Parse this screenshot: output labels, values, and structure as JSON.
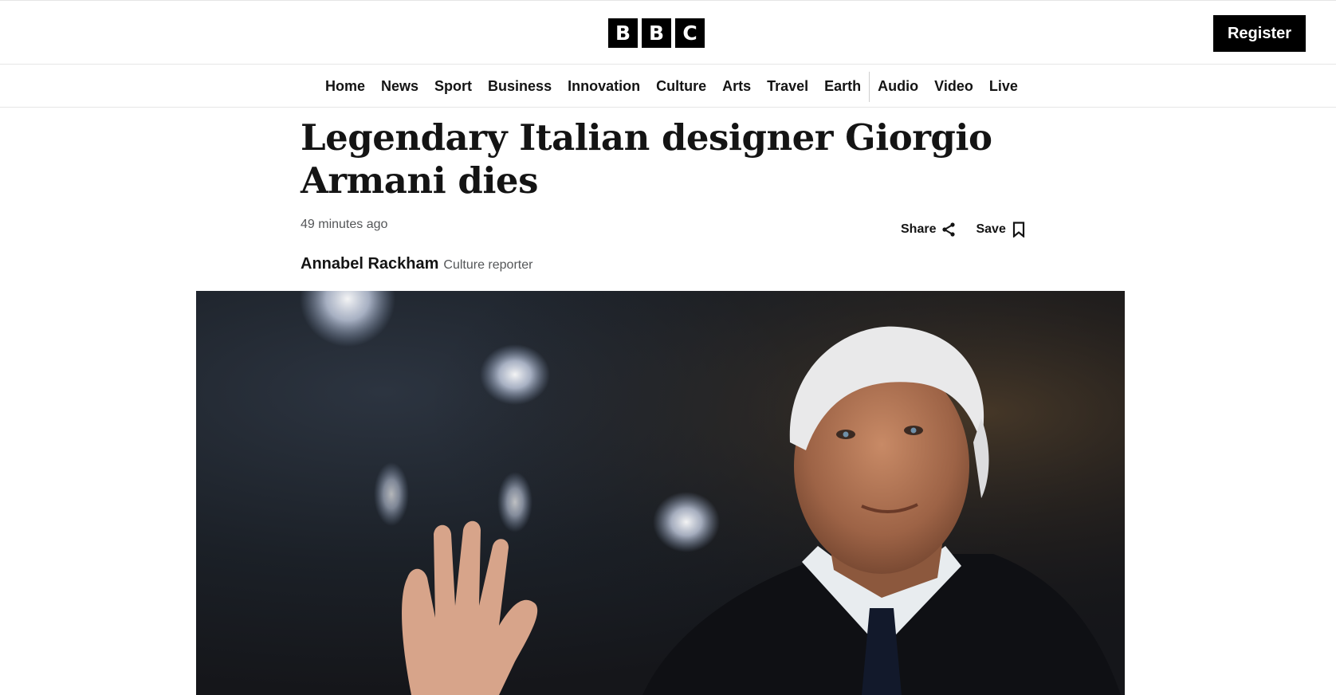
{
  "header": {
    "logo_letters": [
      "B",
      "B",
      "C"
    ],
    "register_label": "Register"
  },
  "nav": {
    "items": [
      "Home",
      "News",
      "Sport",
      "Business",
      "Innovation",
      "Culture",
      "Arts",
      "Travel",
      "Earth",
      "Audio",
      "Video",
      "Live"
    ]
  },
  "article": {
    "headline": "Legendary Italian designer Giorgio Armani dies",
    "timestamp": "49 minutes ago",
    "share_label": "Share",
    "save_label": "Save",
    "author": "Annabel Rackham",
    "author_role": "Culture reporter",
    "hero_image": "photo of Giorgio Armani waving"
  },
  "icons": {
    "share": "share-icon",
    "save": "bookmark-icon"
  }
}
